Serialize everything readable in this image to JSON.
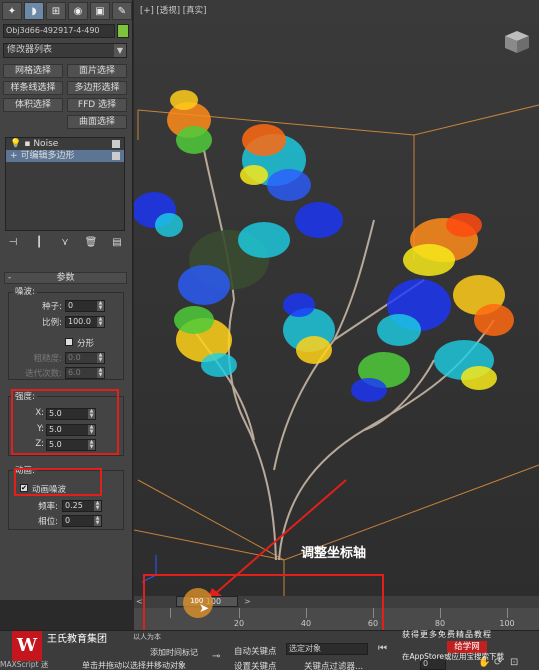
{
  "panel": {
    "tabs": [
      "create-icon",
      "modify-icon",
      "hierarchy-icon",
      "motion-icon",
      "display-icon",
      "utilities-icon"
    ],
    "object_name": "Obj3d66-492917-4-490",
    "object_color": "#7cc23a",
    "modifier_list": "修改器列表",
    "buttons": [
      "网格选择",
      "面片选择",
      "样条线选择",
      "多边形选择",
      "体积选择",
      "FFD 选择",
      "",
      "曲面选择"
    ],
    "stack": [
      {
        "label": "Noise"
      },
      {
        "label": "可编辑多边形"
      }
    ],
    "params": {
      "header": "参数",
      "noise_group": "噪波:",
      "seed_label": "种子:",
      "seed": "0",
      "scale_label": "比例:",
      "scale": "100.0",
      "fractal_label": "分形",
      "roughness_label": "粗糙度:",
      "roughness": "0.0",
      "iterations_label": "迭代次数:",
      "iterations": "6.0",
      "strength_group": "强度:",
      "x_label": "X:",
      "x": "5.0",
      "y_label": "Y:",
      "y": "5.0",
      "z_label": "Z:",
      "z": "5.0",
      "anim_group": "动画:",
      "anim_noise_label": "动画噪波",
      "freq_label": "频率:",
      "freq": "0.25",
      "phase_label": "相位:",
      "phase": "0"
    }
  },
  "viewport": {
    "label": "[+] [透视] [真实]",
    "annotation": "调整坐标轴"
  },
  "timeline": {
    "slider": "0 / 100",
    "ticks": [
      "20",
      "40",
      "60",
      "80",
      "100"
    ],
    "cursor_value": "100"
  },
  "bottom": {
    "brand": "王氏教育集团",
    "brand_sub": "以人为本",
    "logo_text": "W",
    "maxscript": "MAXScript 迷",
    "status1": "单击并拖动以选择并移动对象",
    "status2": "添加时间标记",
    "autokey": "自动关键点",
    "autokey_select": "选定对象",
    "setkey": "设置关键点",
    "key_filter": "关键点过滤器...",
    "frame": "0",
    "watermark_top": "获得更多免费精品教程",
    "watermark_btn": "给学网",
    "watermark_bottom": "在AppStore或应用宝搜索下载"
  }
}
